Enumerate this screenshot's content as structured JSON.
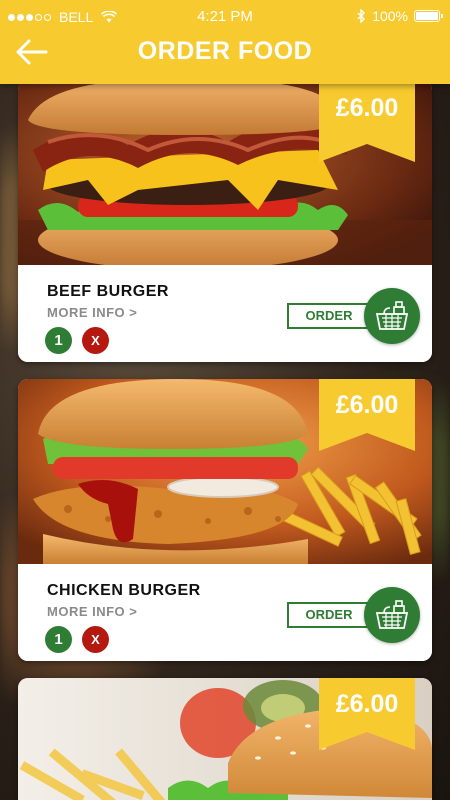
{
  "status_bar": {
    "carrier": "BELL",
    "time": "4:21 PM",
    "battery": "100%"
  },
  "header": {
    "title": "ORDER FOOD"
  },
  "items": [
    {
      "name": "BEEF BURGER",
      "more_info": "MORE INFO >",
      "price": "£6.00",
      "quantity": "1",
      "remove": "X",
      "order_label": "ORDER"
    },
    {
      "name": "CHICKEN BURGER",
      "more_info": "MORE INFO >",
      "price": "£6.00",
      "quantity": "1",
      "remove": "X",
      "order_label": "ORDER"
    },
    {
      "price": "£6.00"
    }
  ],
  "colors": {
    "accent_yellow": "#f7ca2f",
    "order_green": "#2f7d35",
    "remove_red": "#b4180f"
  }
}
